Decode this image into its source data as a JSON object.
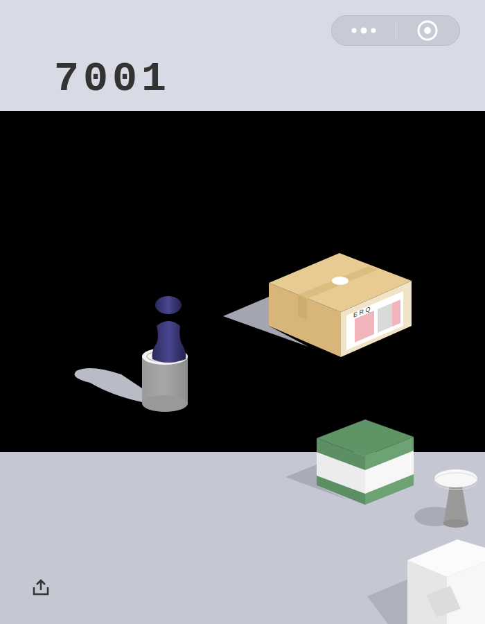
{
  "score": "7001",
  "box_label": "E R Q"
}
